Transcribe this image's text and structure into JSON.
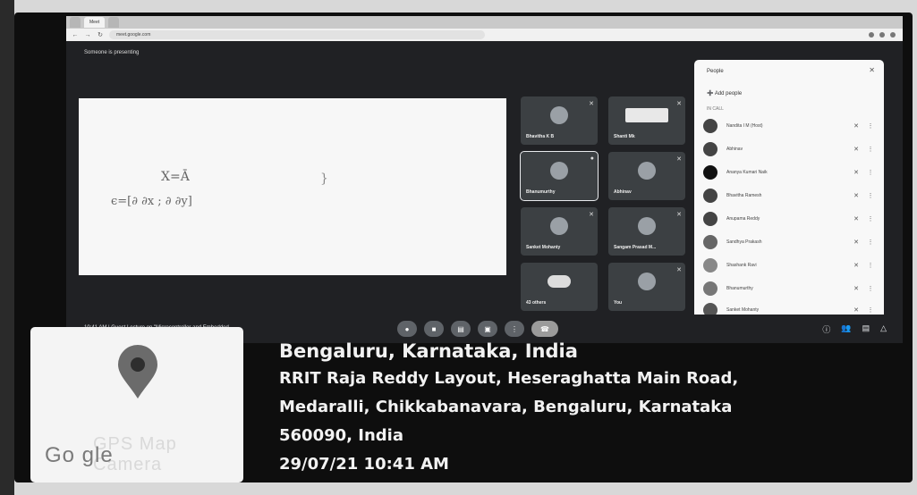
{
  "browser": {
    "tabs": [
      "",
      "Meet",
      ""
    ],
    "url": "meet.google.com",
    "nav_icons": [
      "back-icon",
      "forward-icon",
      "reload-icon"
    ]
  },
  "meet": {
    "presenting_banner": "Someone is presenting",
    "slide": {
      "eq1": "X=Ā",
      "eq2": "ϵ=[∂ ∂x ; ∂ ∂y]",
      "eq3": "}"
    },
    "tiles": [
      {
        "name": "Bhavitha K B",
        "active": false
      },
      {
        "name": "Shanti Mk",
        "active": false
      },
      {
        "name": "Bhanumurthy",
        "active": true
      },
      {
        "name": "Abhinav",
        "active": false
      },
      {
        "name": "Sanket Mohanty",
        "active": false
      },
      {
        "name": "Sangam Prasad M...",
        "active": false
      },
      {
        "name": "43 others",
        "active": false
      },
      {
        "name": "You",
        "active": false
      }
    ],
    "bottom_bar": {
      "time": "10:41 AM",
      "meeting_title": "Guest Lecture on \"Microcontroller and Embedded ..."
    },
    "controls": [
      "mic-icon",
      "camera-icon",
      "captions-icon",
      "present-icon",
      "more-icon",
      "end-call-icon"
    ],
    "right_icons": [
      "info-icon",
      "people-icon",
      "chat-icon",
      "activities-icon"
    ]
  },
  "people_panel": {
    "title": "People",
    "add_people": "Add people",
    "in_call_label": "IN CALL",
    "participants": [
      "Nandita I M (Host)",
      "Abhinav",
      "Ananya Kumari Naik",
      "Bhavitha Ramesh",
      "Anupama Reddy",
      "Sandhya Prakash",
      "Shashank Ravi",
      "Bhanumurthy",
      "Sanket Mohanty"
    ]
  },
  "geo_overlay": {
    "brand": "Go gle",
    "watermark": "GPS Map Camera",
    "city": "Bengaluru, Karnataka, India",
    "address_line1": "RRIT Raja Reddy Layout, Heseraghatta Main Road,",
    "address_line2": "Medaralli, Chikkabanavara, Bengaluru, Karnataka",
    "address_line3": "560090, India",
    "datetime": "29/07/21 10:41 AM",
    "pin_color": "#6b6b6b"
  }
}
